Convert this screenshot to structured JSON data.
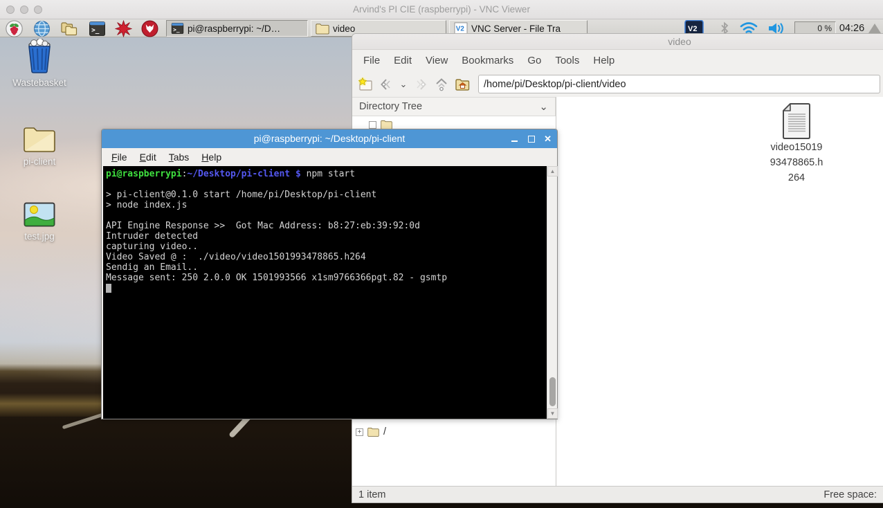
{
  "window": {
    "title": "Arvind's PI CIE (raspberrypi) - VNC Viewer"
  },
  "taskbar": {
    "tasks": [
      {
        "label": "pi@raspberrypi: ~/D…"
      },
      {
        "label": "video"
      },
      {
        "label": "VNC Server - File Tra"
      }
    ],
    "cpu": "0 %",
    "clock": "04:26"
  },
  "desktop": {
    "icons": [
      {
        "label": "Wastebasket"
      },
      {
        "label": "pi-client"
      },
      {
        "label": "test.jpg"
      }
    ]
  },
  "file_manager": {
    "title": "video",
    "menus": [
      "File",
      "Edit",
      "View",
      "Bookmarks",
      "Go",
      "Tools",
      "Help"
    ],
    "path": "/home/pi/Desktop/pi-client/video",
    "side_header": "Directory Tree",
    "side_header_chevron": "⌄",
    "toolbar_chevron": "⌄",
    "tree_root": "/",
    "tree_expander": "+",
    "file": {
      "line1": "video15019",
      "line2": "93478865.h",
      "line3": "264"
    },
    "status_items": "1 item",
    "status_free": "Free space:"
  },
  "terminal": {
    "title": "pi@raspberrypi: ~/Desktop/pi-client",
    "menus": [
      "File",
      "Edit",
      "Tabs",
      "Help"
    ],
    "prompt": {
      "user": "pi@raspberrypi",
      "colon": ":",
      "path": "~/Desktop/pi-client",
      "dollar": " $ ",
      "command": "npm start"
    },
    "lines": [
      "",
      "> pi-client@0.1.0 start /home/pi/Desktop/pi-client",
      "> node index.js",
      "",
      "API Engine Response >>  Got Mac Address: b8:27:eb:39:92:0d",
      "Intruder detected",
      "capturing video..",
      "Video Saved @ :  ./video/video1501993478865.h264",
      "Sendig an Email..",
      "Message sent: 250 2.0.0 OK 1501993566 x1sm9766366pgt.82 - gsmtp"
    ],
    "scroll_up": "▲",
    "scroll_down": "▼"
  },
  "colors": {
    "terminal_titlebar": "#4e96d5",
    "prompt_green": "#3fe03f",
    "prompt_blue": "#5458f0",
    "wifi_blue": "#2196e0",
    "vnc_navy": "#16243f"
  }
}
